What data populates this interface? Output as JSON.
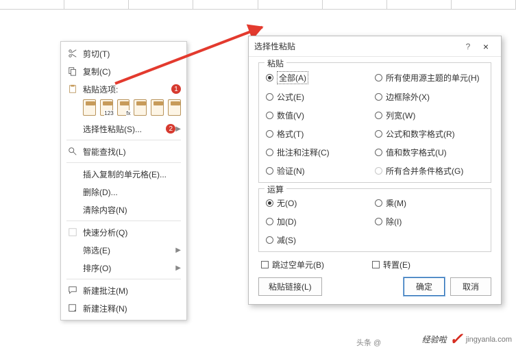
{
  "context_menu": {
    "cut": "剪切(T)",
    "copy": "复制(C)",
    "paste_options": "粘贴选项:",
    "paste_special": "选择性粘贴(S)...",
    "smart_lookup": "智能查找(L)",
    "insert_copied": "插入复制的单元格(E)...",
    "delete": "删除(D)...",
    "clear": "清除内容(N)",
    "quick_analysis": "快速分析(Q)",
    "filter": "筛选(E)",
    "sort": "排序(O)",
    "new_comment": "新建批注(M)",
    "new_note": "新建注释(N)"
  },
  "badges": {
    "b1": "1",
    "b2": "2"
  },
  "dialog": {
    "title": "选择性粘贴",
    "help": "?",
    "close": "×",
    "group_paste": "粘贴",
    "group_op": "运算",
    "paste_opts_left": [
      "全部(A)",
      "公式(E)",
      "数值(V)",
      "格式(T)",
      "批注和注释(C)",
      "验证(N)"
    ],
    "paste_opts_right": [
      "所有使用源主题的单元(H)",
      "边框除外(X)",
      "列宽(W)",
      "公式和数字格式(R)",
      "值和数字格式(U)",
      "所有合并条件格式(G)"
    ],
    "op_left": [
      "无(O)",
      "加(D)",
      "减(S)"
    ],
    "op_right": [
      "乘(M)",
      "除(I)"
    ],
    "skip_blanks": "跳过空单元(B)",
    "transpose": "转置(E)",
    "paste_link": "粘贴链接(L)",
    "ok": "确定",
    "cancel": "取消"
  },
  "watermark": {
    "big": "经验啦",
    "small": "jingyanla.com"
  },
  "toutiao": "头条 @"
}
